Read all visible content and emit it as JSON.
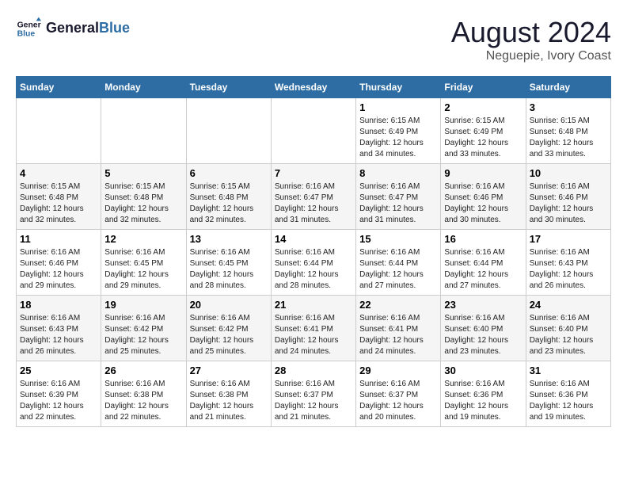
{
  "header": {
    "logo_line1": "General",
    "logo_line2": "Blue",
    "month_title": "August 2024",
    "location": "Neguepie, Ivory Coast"
  },
  "weekdays": [
    "Sunday",
    "Monday",
    "Tuesday",
    "Wednesday",
    "Thursday",
    "Friday",
    "Saturday"
  ],
  "weeks": [
    [
      {
        "day": "",
        "sunrise": "",
        "sunset": "",
        "daylight": ""
      },
      {
        "day": "",
        "sunrise": "",
        "sunset": "",
        "daylight": ""
      },
      {
        "day": "",
        "sunrise": "",
        "sunset": "",
        "daylight": ""
      },
      {
        "day": "",
        "sunrise": "",
        "sunset": "",
        "daylight": ""
      },
      {
        "day": "1",
        "sunrise": "Sunrise: 6:15 AM",
        "sunset": "Sunset: 6:49 PM",
        "daylight": "Daylight: 12 hours and 34 minutes."
      },
      {
        "day": "2",
        "sunrise": "Sunrise: 6:15 AM",
        "sunset": "Sunset: 6:49 PM",
        "daylight": "Daylight: 12 hours and 33 minutes."
      },
      {
        "day": "3",
        "sunrise": "Sunrise: 6:15 AM",
        "sunset": "Sunset: 6:48 PM",
        "daylight": "Daylight: 12 hours and 33 minutes."
      }
    ],
    [
      {
        "day": "4",
        "sunrise": "Sunrise: 6:15 AM",
        "sunset": "Sunset: 6:48 PM",
        "daylight": "Daylight: 12 hours and 32 minutes."
      },
      {
        "day": "5",
        "sunrise": "Sunrise: 6:15 AM",
        "sunset": "Sunset: 6:48 PM",
        "daylight": "Daylight: 12 hours and 32 minutes."
      },
      {
        "day": "6",
        "sunrise": "Sunrise: 6:15 AM",
        "sunset": "Sunset: 6:48 PM",
        "daylight": "Daylight: 12 hours and 32 minutes."
      },
      {
        "day": "7",
        "sunrise": "Sunrise: 6:16 AM",
        "sunset": "Sunset: 6:47 PM",
        "daylight": "Daylight: 12 hours and 31 minutes."
      },
      {
        "day": "8",
        "sunrise": "Sunrise: 6:16 AM",
        "sunset": "Sunset: 6:47 PM",
        "daylight": "Daylight: 12 hours and 31 minutes."
      },
      {
        "day": "9",
        "sunrise": "Sunrise: 6:16 AM",
        "sunset": "Sunset: 6:46 PM",
        "daylight": "Daylight: 12 hours and 30 minutes."
      },
      {
        "day": "10",
        "sunrise": "Sunrise: 6:16 AM",
        "sunset": "Sunset: 6:46 PM",
        "daylight": "Daylight: 12 hours and 30 minutes."
      }
    ],
    [
      {
        "day": "11",
        "sunrise": "Sunrise: 6:16 AM",
        "sunset": "Sunset: 6:46 PM",
        "daylight": "Daylight: 12 hours and 29 minutes."
      },
      {
        "day": "12",
        "sunrise": "Sunrise: 6:16 AM",
        "sunset": "Sunset: 6:45 PM",
        "daylight": "Daylight: 12 hours and 29 minutes."
      },
      {
        "day": "13",
        "sunrise": "Sunrise: 6:16 AM",
        "sunset": "Sunset: 6:45 PM",
        "daylight": "Daylight: 12 hours and 28 minutes."
      },
      {
        "day": "14",
        "sunrise": "Sunrise: 6:16 AM",
        "sunset": "Sunset: 6:44 PM",
        "daylight": "Daylight: 12 hours and 28 minutes."
      },
      {
        "day": "15",
        "sunrise": "Sunrise: 6:16 AM",
        "sunset": "Sunset: 6:44 PM",
        "daylight": "Daylight: 12 hours and 27 minutes."
      },
      {
        "day": "16",
        "sunrise": "Sunrise: 6:16 AM",
        "sunset": "Sunset: 6:44 PM",
        "daylight": "Daylight: 12 hours and 27 minutes."
      },
      {
        "day": "17",
        "sunrise": "Sunrise: 6:16 AM",
        "sunset": "Sunset: 6:43 PM",
        "daylight": "Daylight: 12 hours and 26 minutes."
      }
    ],
    [
      {
        "day": "18",
        "sunrise": "Sunrise: 6:16 AM",
        "sunset": "Sunset: 6:43 PM",
        "daylight": "Daylight: 12 hours and 26 minutes."
      },
      {
        "day": "19",
        "sunrise": "Sunrise: 6:16 AM",
        "sunset": "Sunset: 6:42 PM",
        "daylight": "Daylight: 12 hours and 25 minutes."
      },
      {
        "day": "20",
        "sunrise": "Sunrise: 6:16 AM",
        "sunset": "Sunset: 6:42 PM",
        "daylight": "Daylight: 12 hours and 25 minutes."
      },
      {
        "day": "21",
        "sunrise": "Sunrise: 6:16 AM",
        "sunset": "Sunset: 6:41 PM",
        "daylight": "Daylight: 12 hours and 24 minutes."
      },
      {
        "day": "22",
        "sunrise": "Sunrise: 6:16 AM",
        "sunset": "Sunset: 6:41 PM",
        "daylight": "Daylight: 12 hours and 24 minutes."
      },
      {
        "day": "23",
        "sunrise": "Sunrise: 6:16 AM",
        "sunset": "Sunset: 6:40 PM",
        "daylight": "Daylight: 12 hours and 23 minutes."
      },
      {
        "day": "24",
        "sunrise": "Sunrise: 6:16 AM",
        "sunset": "Sunset: 6:40 PM",
        "daylight": "Daylight: 12 hours and 23 minutes."
      }
    ],
    [
      {
        "day": "25",
        "sunrise": "Sunrise: 6:16 AM",
        "sunset": "Sunset: 6:39 PM",
        "daylight": "Daylight: 12 hours and 22 minutes."
      },
      {
        "day": "26",
        "sunrise": "Sunrise: 6:16 AM",
        "sunset": "Sunset: 6:38 PM",
        "daylight": "Daylight: 12 hours and 22 minutes."
      },
      {
        "day": "27",
        "sunrise": "Sunrise: 6:16 AM",
        "sunset": "Sunset: 6:38 PM",
        "daylight": "Daylight: 12 hours and 21 minutes."
      },
      {
        "day": "28",
        "sunrise": "Sunrise: 6:16 AM",
        "sunset": "Sunset: 6:37 PM",
        "daylight": "Daylight: 12 hours and 21 minutes."
      },
      {
        "day": "29",
        "sunrise": "Sunrise: 6:16 AM",
        "sunset": "Sunset: 6:37 PM",
        "daylight": "Daylight: 12 hours and 20 minutes."
      },
      {
        "day": "30",
        "sunrise": "Sunrise: 6:16 AM",
        "sunset": "Sunset: 6:36 PM",
        "daylight": "Daylight: 12 hours and 19 minutes."
      },
      {
        "day": "31",
        "sunrise": "Sunrise: 6:16 AM",
        "sunset": "Sunset: 6:36 PM",
        "daylight": "Daylight: 12 hours and 19 minutes."
      }
    ]
  ]
}
